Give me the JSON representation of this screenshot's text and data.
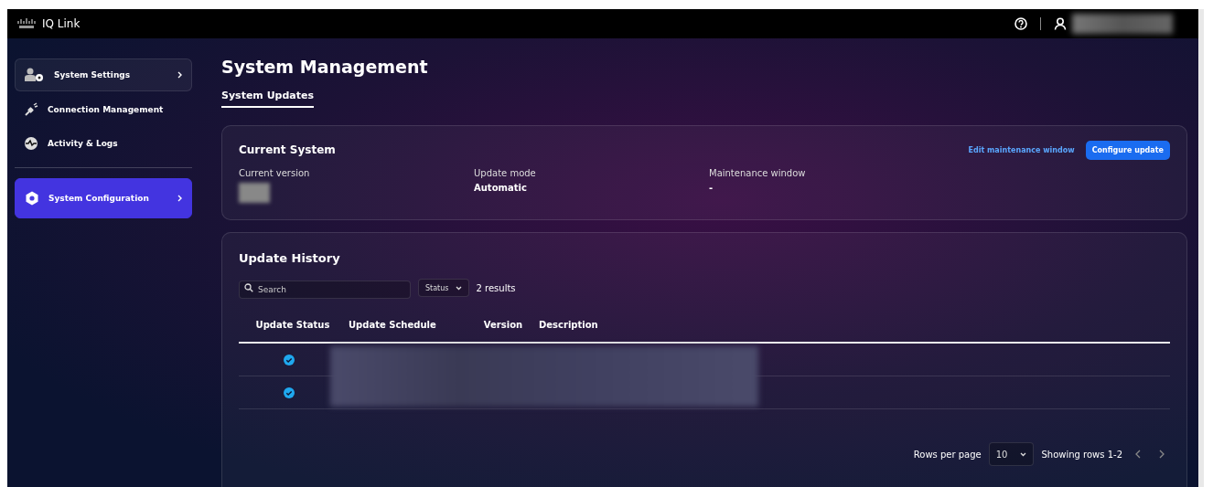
{
  "topbar": {
    "brand": "IQ Link"
  },
  "sidebar": {
    "items": [
      {
        "label": "System Settings",
        "kind": "group",
        "selected": false
      },
      {
        "label": "Connection Management",
        "kind": "link",
        "selected": false
      },
      {
        "label": "Activity & Logs",
        "kind": "link",
        "selected": false
      },
      {
        "label": "System Configuration",
        "kind": "group",
        "selected": true
      }
    ]
  },
  "page": {
    "title": "System Management",
    "tabs": [
      {
        "label": "System Updates",
        "selected": true
      }
    ]
  },
  "current_system": {
    "title": "Current System",
    "link": "Edit maintenance window",
    "button": "Configure update",
    "fields": [
      {
        "label": "Current version",
        "kind": "redacted"
      },
      {
        "label": "Update mode",
        "value": "Automatic",
        "kind": "text"
      },
      {
        "label": "Maintenance window",
        "value": "-",
        "kind": "text"
      }
    ]
  },
  "update_history": {
    "title": "Update History",
    "search": {
      "placeholder": "Search"
    },
    "filter": "Status",
    "results": "2 results",
    "columns": [
      "Update Status",
      "Update Schedule",
      "Version",
      "Description"
    ],
    "rows": [
      {
        "kind": "completed"
      },
      {
        "kind": "completed"
      }
    ],
    "pagination": {
      "rows_label": "Rows per page",
      "rows_value": "10",
      "showing": "Showing rows 1-2"
    }
  }
}
